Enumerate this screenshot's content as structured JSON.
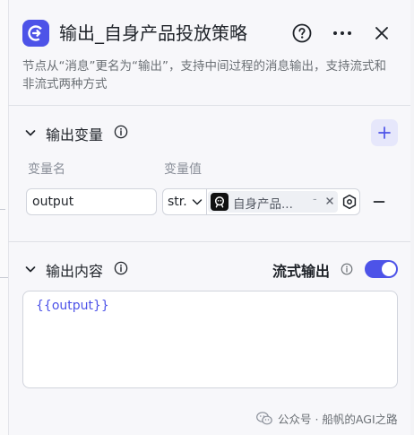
{
  "header": {
    "title": "输出_自身产品投放策略",
    "description": "节点从“消息”更名为“输出”，支持中间过程的消息输出，支持流式和非流式两种方式"
  },
  "output_variables": {
    "section_title": "输出变量",
    "column_name_label": "变量名",
    "column_value_label": "变量值",
    "rows": [
      {
        "name": "output",
        "type": "str.",
        "reference_text": "自身产品...",
        "reference_dash": "-"
      }
    ]
  },
  "output_content": {
    "section_title": "输出内容",
    "stream_label": "流式输出",
    "stream_enabled": true,
    "content": "{{output}}"
  },
  "watermark": {
    "text": "公众号 · 船帆的AGI之路"
  },
  "colors": {
    "accent": "#4d53e8",
    "panel_bg": "#f7f7fa",
    "muted_text": "#6b7075"
  }
}
